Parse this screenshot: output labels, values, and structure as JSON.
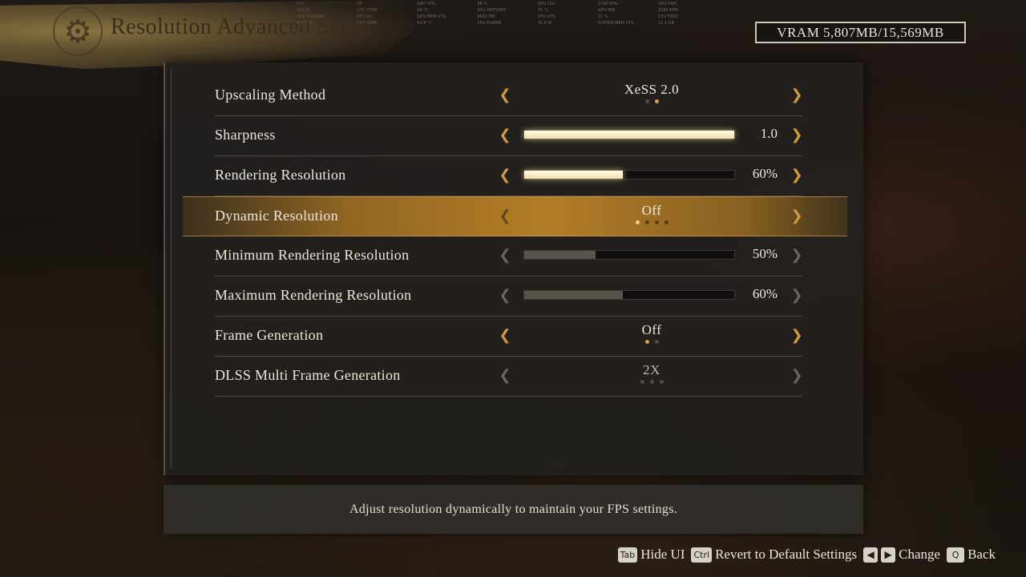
{
  "hud": [
    "FPS",
    "36",
    "GPU UTIL",
    "98 %",
    "GPU CLK",
    "2190 MHz",
    "GPU PWR",
    "204 W",
    "GPU TEMP",
    "64 °C",
    "GPU HOTSPOT",
    "75 °C",
    "GPU FAN",
    "1030 RPM",
    "GPU VOLTAGE",
    "837 mV",
    "GPU MEM UTIL",
    "6693 MB",
    "CPU UTIL",
    "31 %",
    "CPU FREQ",
    "4.5 GHz",
    "CPU TEMP",
    "54.8 °C",
    "CPU POWER",
    "35.5 W",
    "SYSTEM MEM UTIL",
    "12.1 GB"
  ],
  "header": {
    "title": "Resolution Advanced Settin",
    "icon": "gear-icon",
    "vram": "VRAM 5,807MB/15,569MB"
  },
  "settings": [
    {
      "label": "Upscaling Method",
      "type": "choice",
      "value": "XeSS 2.0",
      "dots": [
        false,
        true
      ],
      "active_index": 1,
      "disabled": false
    },
    {
      "label": "Sharpness",
      "type": "slider",
      "value": "1.0",
      "fill_fraction": 1.0,
      "disabled": false
    },
    {
      "label": "Rendering Resolution",
      "type": "slider",
      "value": "60%",
      "fill_fraction": 0.47,
      "disabled": false
    },
    {
      "label": "Dynamic Resolution",
      "type": "choice",
      "value": "Off",
      "dots": [
        true,
        false,
        false,
        false
      ],
      "active_index": 0,
      "highlighted": true,
      "disabled": false
    },
    {
      "label": "Minimum Rendering Resolution",
      "type": "slider",
      "value": "50%",
      "fill_fraction": 0.34,
      "disabled": true
    },
    {
      "label": "Maximum Rendering Resolution",
      "type": "slider",
      "value": "60%",
      "fill_fraction": 0.47,
      "disabled": true
    },
    {
      "label": "Frame Generation",
      "type": "choice",
      "value": "Off",
      "dots": [
        true,
        false
      ],
      "active_index": 0,
      "disabled": false
    },
    {
      "label": "DLSS Multi Frame Generation",
      "type": "choice",
      "value": "2X",
      "dots": [
        false,
        false,
        false
      ],
      "active_index": -1,
      "disabled": true
    }
  ],
  "description": "Adjust resolution dynamically to maintain your FPS settings.",
  "footer": {
    "hide_ui_key": "Tab",
    "hide_ui_label": "Hide UI",
    "revert_key": "Ctrl",
    "revert_label": "Revert to Default Settings",
    "change_label": "Change",
    "back_key": "Q",
    "back_label": "Back"
  },
  "colors": {
    "accent": "#d09a3e",
    "highlight": "#b9822a",
    "text": "#ede7dc"
  }
}
